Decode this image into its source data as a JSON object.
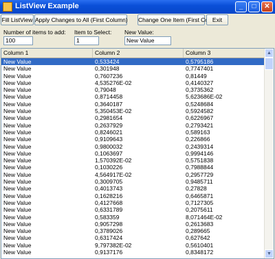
{
  "window": {
    "title": "ListView Example"
  },
  "titlebar_buttons": {
    "minimize": "_",
    "maximize": "□",
    "close": "✕"
  },
  "toolbar": {
    "fill": "Fill ListView",
    "apply_all": "Apply Changes to All (First Column)",
    "change_one": "Change One Item (First Column)",
    "exit": "Exit"
  },
  "form": {
    "count_label": "Number of items to add:",
    "count_value": "100",
    "select_label": "Item to Select:",
    "select_value": "1",
    "newvalue_label": "New Value:",
    "newvalue_value": "New Value"
  },
  "list": {
    "columns": [
      "Column 1",
      "Column 2",
      "Column 3"
    ],
    "scroll_up": "▲",
    "scroll_down": "▼",
    "rows": [
      [
        "New Value",
        "0,533424",
        "0,5795186"
      ],
      [
        "New Value",
        "0,301948",
        "0,7747401"
      ],
      [
        "New Value",
        "0,7607236",
        "0,81449"
      ],
      [
        "New Value",
        "4,535276E-02",
        "0,4140327"
      ],
      [
        "New Value",
        "0,79048",
        "0,3735362"
      ],
      [
        "New Value",
        "0,8714458",
        "5,623686E-02"
      ],
      [
        "New Value",
        "0,3640187",
        "0,5248684"
      ],
      [
        "New Value",
        "5,350453E-02",
        "0,5924582"
      ],
      [
        "New Value",
        "0,2981654",
        "0,6226967"
      ],
      [
        "New Value",
        "0,2637929",
        "0,2793421"
      ],
      [
        "New Value",
        "0,8246021",
        "0,589163"
      ],
      [
        "New Value",
        "0,9109643",
        "0,226866"
      ],
      [
        "New Value",
        "0,9800032",
        "0,2439314"
      ],
      [
        "New Value",
        "0,1063697",
        "0,9994146"
      ],
      [
        "New Value",
        "1,570392E-02",
        "0,5751838"
      ],
      [
        "New Value",
        "0,1030226",
        "0,7988844"
      ],
      [
        "New Value",
        "4,564917E-02",
        "0,2957729"
      ],
      [
        "New Value",
        "0,3009705",
        "0,9485711"
      ],
      [
        "New Value",
        "0,4013743",
        "0,27828"
      ],
      [
        "New Value",
        "0,1628216",
        "0,6465871"
      ],
      [
        "New Value",
        "0,4127668",
        "0,7127305"
      ],
      [
        "New Value",
        "0,6331789",
        "0,2075611"
      ],
      [
        "New Value",
        "0,583359",
        "8,071464E-02"
      ],
      [
        "New Value",
        "0,9057298",
        "0,2613683"
      ],
      [
        "New Value",
        "0,3789026",
        "0,289665"
      ],
      [
        "New Value",
        "0,6317424",
        "0,627642"
      ],
      [
        "New Value",
        "9,797382E-02",
        "0,5610401"
      ],
      [
        "New Value",
        "0,9137176",
        "0,8348172"
      ]
    ]
  }
}
